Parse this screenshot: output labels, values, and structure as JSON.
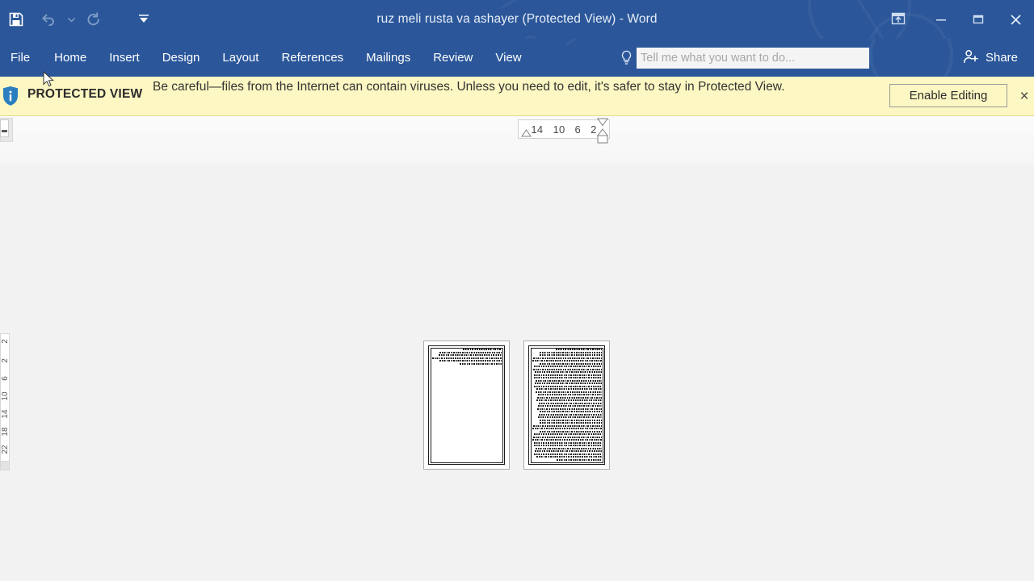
{
  "window": {
    "title": "ruz meli rusta va ashayer (Protected View) - Word",
    "app_name": "Word",
    "document_name": "ruz meli rusta va ashayer",
    "mode": "Protected View",
    "theme_color": "#2b579a"
  },
  "quick_access_toolbar": {
    "items": [
      {
        "name": "save",
        "icon": "save-icon",
        "enabled": true
      },
      {
        "name": "undo",
        "icon": "undo-icon",
        "enabled": false
      },
      {
        "name": "undo-dropdown",
        "icon": "chevron-down-icon",
        "enabled": false
      },
      {
        "name": "redo",
        "icon": "redo-icon",
        "enabled": false
      },
      {
        "name": "customize",
        "icon": "customize-qat-icon",
        "enabled": true
      }
    ]
  },
  "window_controls": {
    "ribbon_display_options": "Ribbon Display Options",
    "minimize": "Minimize",
    "restore": "Restore Down",
    "close": "Close"
  },
  "ribbon": {
    "tabs": [
      {
        "label": "File",
        "active": false
      },
      {
        "label": "Home",
        "active": false
      },
      {
        "label": "Insert",
        "active": false
      },
      {
        "label": "Design",
        "active": false
      },
      {
        "label": "Layout",
        "active": false
      },
      {
        "label": "References",
        "active": false
      },
      {
        "label": "Mailings",
        "active": false
      },
      {
        "label": "Review",
        "active": false
      },
      {
        "label": "View",
        "active": false
      }
    ],
    "collapsed": true
  },
  "tell_me": {
    "placeholder": "Tell me what you want to do...",
    "value": "",
    "icon": "lightbulb-icon"
  },
  "share": {
    "label": "Share",
    "icon": "person-add-icon"
  },
  "protected_view": {
    "icon": "info-shield-icon",
    "label": "PROTECTED VIEW",
    "message": "Be careful—files from the Internet can contain viruses. Unless you need to edit, it's safer to stay in Protected View.",
    "enable_editing_label": "Enable Editing",
    "close_label": "×",
    "background_color": "#fdf7c3"
  },
  "rulers": {
    "horizontal": {
      "ticks": [
        "14",
        "10",
        "6",
        "2"
      ],
      "unit": "cm",
      "direction": "rtl"
    },
    "vertical": {
      "ticks": [
        "2",
        "2",
        "6",
        "10",
        "14",
        "18",
        "22"
      ],
      "unit": "cm"
    },
    "tab_stop_selector": "left-tab-stop"
  },
  "document": {
    "zoom_level_note": "thumbnail-multipage-view",
    "page_count": 2,
    "pages": [
      {
        "number": 1,
        "text_lines": 6,
        "fill": "partial"
      },
      {
        "number": 2,
        "text_lines": 40,
        "fill": "full"
      }
    ]
  }
}
